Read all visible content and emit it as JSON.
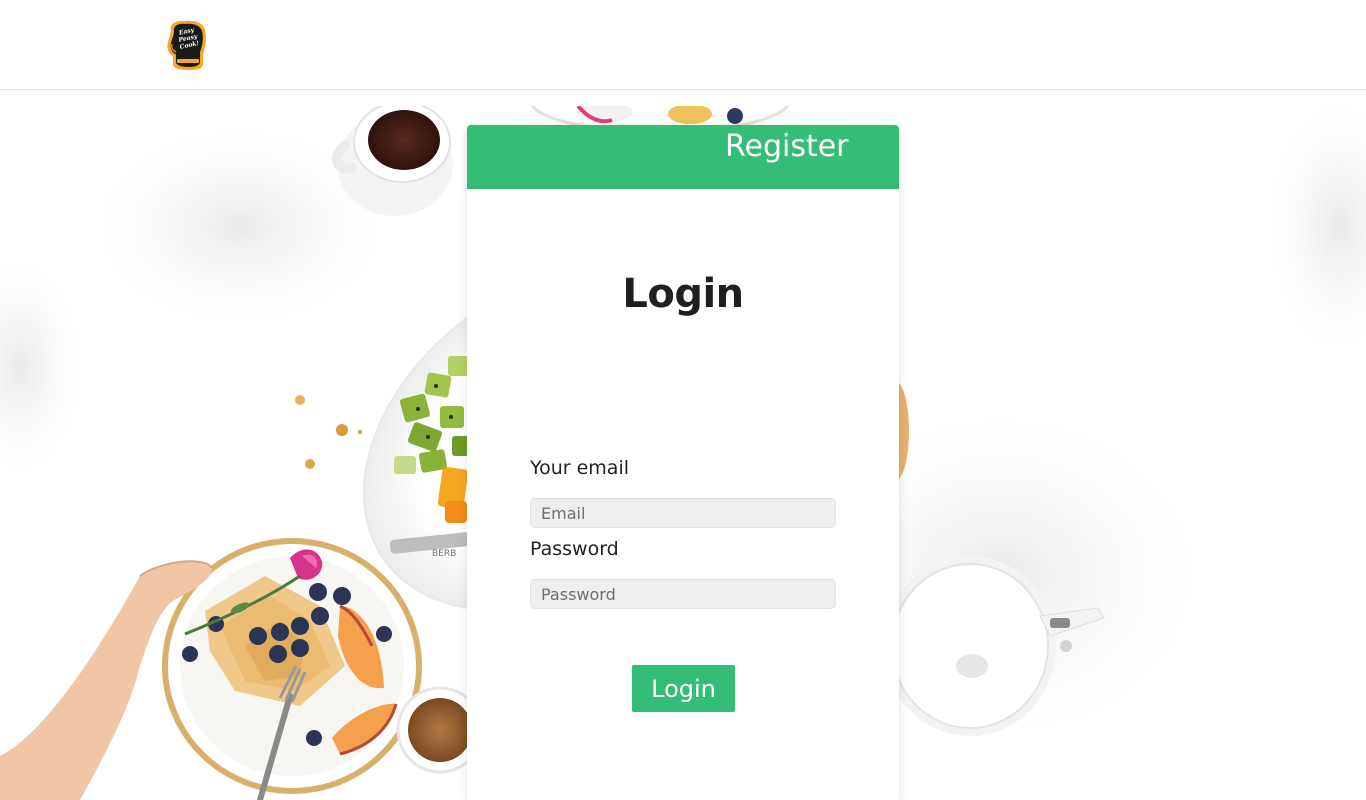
{
  "header": {
    "logo_text": "Easy Peasy Cook!"
  },
  "card": {
    "register_label": "Register",
    "title": "Login",
    "email_label": "Your email",
    "email_placeholder": "Email",
    "email_value": "",
    "password_label": "Password",
    "password_placeholder": "Password",
    "password_value": "",
    "login_button_label": "Login"
  },
  "colors": {
    "accent": "#33bd75",
    "logo_orange": "#f5a623",
    "logo_dark": "#1a1a1a",
    "input_bg": "#eeeeee"
  },
  "icons": {
    "logo": "oven-mitt-logo"
  }
}
